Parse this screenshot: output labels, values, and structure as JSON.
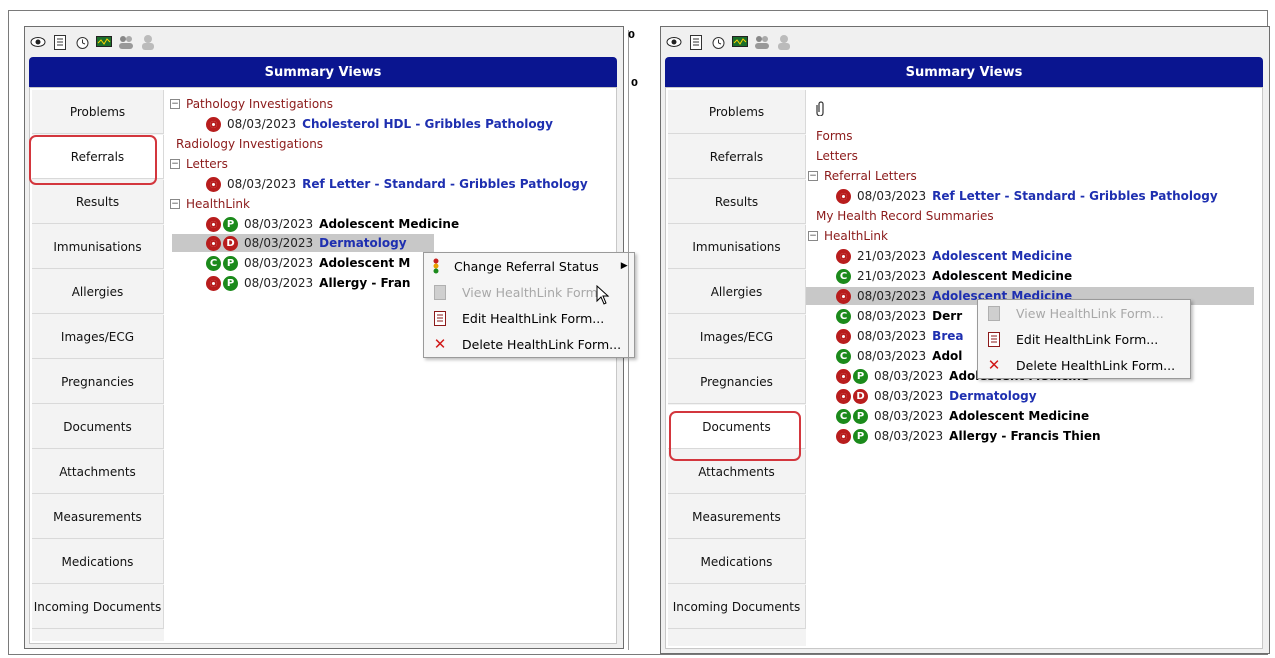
{
  "left": {
    "toolbar_icons": [
      "eye-icon",
      "document-icon",
      "alarm-icon",
      "monitor-icon",
      "users-icon",
      "person-icon"
    ],
    "title": "Summary Views",
    "sidebar": [
      "Problems",
      "Referrals",
      "Results",
      "Immunisations",
      "Allergies",
      "Images/ECG",
      "Pregnancies",
      "Documents",
      "Attachments",
      "Measurements",
      "Medications",
      "Incoming Documents"
    ],
    "highlighted_sidebar": "Referrals",
    "tree": {
      "pathology": "Pathology Investigations",
      "pathology_item": {
        "date": "08/03/2023",
        "title": "Cholesterol HDL - Gribbles Pathology"
      },
      "radiology": "Radiology Investigations",
      "letters": "Letters",
      "letters_item": {
        "date": "08/03/2023",
        "title": "Ref Letter - Standard - Gribbles Pathology"
      },
      "healthlink": "HealthLink",
      "healthlink_items": [
        {
          "date": "08/03/2023",
          "title": "Adolescent Medicine",
          "icons": [
            "ring",
            "P"
          ]
        },
        {
          "date": "08/03/2023",
          "title": "Dermatology",
          "icons": [
            "ring",
            "D"
          ]
        },
        {
          "date": "08/03/2023",
          "title": "Adolescent M",
          "icons": [
            "C",
            "P"
          ]
        },
        {
          "date": "08/03/2023",
          "title": "Allergy - Fran",
          "icons": [
            "ring",
            "P"
          ]
        }
      ]
    },
    "context_menu": [
      "Change Referral Status",
      "View HealthLink Form...",
      "Edit HealthLink Form...",
      "Delete HealthLink Form..."
    ],
    "divider_text": [
      "0",
      "0"
    ]
  },
  "right": {
    "title": "Summary Views",
    "sidebar": [
      "Problems",
      "Referrals",
      "Results",
      "Immunisations",
      "Allergies",
      "Images/ECG",
      "Pregnancies",
      "Documents",
      "Attachments",
      "Measurements",
      "Medications",
      "Incoming Documents"
    ],
    "highlighted_sidebar": "Documents",
    "tree": {
      "forms": "Forms",
      "letters": "Letters",
      "referral_letters": "Referral Letters",
      "referral_item": {
        "date": "08/03/2023",
        "title": "Ref Letter - Standard - Gribbles Pathology"
      },
      "my_health": "My Health Record Summaries",
      "healthlink": "HealthLink",
      "healthlink_items": [
        {
          "date": "21/03/2023",
          "title": "Adolescent Medicine",
          "icons": [
            "ring"
          ],
          "style": "link"
        },
        {
          "date": "21/03/2023",
          "title": "Adolescent Medicine",
          "icons": [
            "C"
          ],
          "style": "bold"
        },
        {
          "date": "08/03/2023",
          "title": "Adolescent Medicine",
          "icons": [
            "ring"
          ],
          "style": "link"
        },
        {
          "date": "08/03/2023",
          "title": "Derr",
          "icons": [
            "C"
          ],
          "style": "bold"
        },
        {
          "date": "08/03/2023",
          "title": "Brea",
          "icons": [
            "ring"
          ],
          "style": "link"
        },
        {
          "date": "08/03/2023",
          "title": "Adol",
          "icons": [
            "C"
          ],
          "style": "bold"
        },
        {
          "date": "08/03/2023",
          "title": "Adolescent Medicine",
          "icons": [
            "ring",
            "P"
          ],
          "style": "bold"
        },
        {
          "date": "08/03/2023",
          "title": "Dermatology",
          "icons": [
            "ring",
            "D"
          ],
          "style": "link"
        },
        {
          "date": "08/03/2023",
          "title": "Adolescent Medicine",
          "icons": [
            "C",
            "P"
          ],
          "style": "bold"
        },
        {
          "date": "08/03/2023",
          "title": "Allergy - Francis Thien",
          "icons": [
            "ring",
            "P"
          ],
          "style": "bold"
        }
      ]
    },
    "context_menu": [
      "View HealthLink Form...",
      "Edit HealthLink Form...",
      "Delete HealthLink Form..."
    ]
  },
  "colors": {
    "title_bar": "#0a1590",
    "link": "#1e2fb0",
    "category": "#8b1a1a",
    "highlight": "#d3363d",
    "status_red": "#b81d1d",
    "status_green": "#1b8a1b"
  }
}
